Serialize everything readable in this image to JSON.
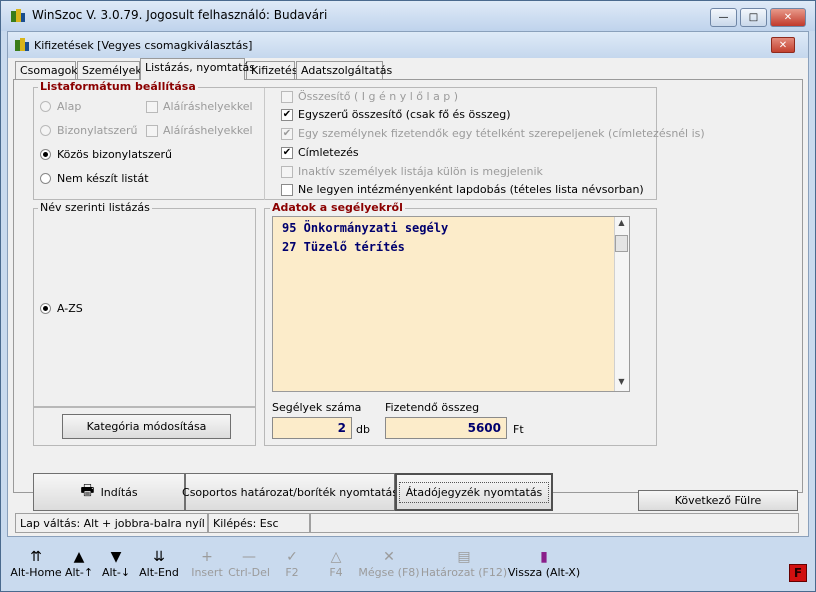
{
  "window": {
    "title": "WinSzoc V. 3.0.79.  Jogosult felhasználó: Budavári",
    "controls": {
      "minimize": "—",
      "maximize": "□",
      "close": "✕"
    }
  },
  "dialog": {
    "title": "Kifizetések  [Vegyes csomagkiválasztás]",
    "close": "✕"
  },
  "tabs": [
    "Csomagok",
    "Személyek",
    "Listázás, nyomtatás",
    "Kifizetés",
    "Adatszolgáltatás"
  ],
  "format_group": {
    "title": "Listaformátum beállítása",
    "radios": [
      {
        "label": "Alap",
        "checked": false,
        "disabled": true
      },
      {
        "label": "Bizonylatszerű",
        "checked": false,
        "disabled": true
      },
      {
        "label": "Közös bizonylatszerű",
        "checked": true,
        "disabled": false
      },
      {
        "label": "Nem készít listát",
        "checked": false,
        "disabled": false
      }
    ],
    "signature_checks": [
      "Aláíráshelyekkel",
      "Aláíráshelyekkel"
    ]
  },
  "options": [
    {
      "label": "Összesítő  ( I g é n y l ő l a p )",
      "checked": false,
      "disabled": true
    },
    {
      "label": "Egyszerű összesítő (csak fő és összeg)",
      "checked": true,
      "disabled": false
    },
    {
      "label": "Egy személynek fizetendők egy tételként szerepeljenek (címletezésnél is)",
      "checked": true,
      "disabled": true
    },
    {
      "label": "Címletezés",
      "checked": true,
      "disabled": false
    },
    {
      "label": "Inaktív személyek listája külön is megjelenik",
      "checked": false,
      "disabled": true
    },
    {
      "label": "Ne legyen intézményenként lapdobás (tételes lista névsorban)",
      "checked": false,
      "disabled": false
    }
  ],
  "name_group": {
    "title": "Név szerinti listázás",
    "radio_label": "A-ZS",
    "button": "Kategória módosítása"
  },
  "adatok": {
    "title": "Adatok a segélyekről",
    "items": [
      "95 Önkormányzati segély",
      "27 Tüzelő térítés"
    ],
    "count_label": "Segélyek száma",
    "count_value": "2",
    "count_unit": "db",
    "amount_label": "Fizetendő összeg",
    "amount_value": "5600",
    "amount_unit": "Ft"
  },
  "actions": {
    "start": "Indítás",
    "group_print": "Csoportos határozat/boríték nyomtatás",
    "transfer_print": "Átadójegyzék nyomtatás",
    "next_tab": "Következő Fülre"
  },
  "status": {
    "hint": "Lap váltás: Alt + jobbra-balra nyíl",
    "exit": "Kilépés: Esc"
  },
  "toolbar": [
    {
      "label": "Alt-Home",
      "icon": "⇈",
      "disabled": false
    },
    {
      "label": "Alt-↑",
      "icon": "▲",
      "disabled": false
    },
    {
      "label": "Alt-↓",
      "icon": "▼",
      "disabled": false
    },
    {
      "label": "Alt-End",
      "icon": "⇊",
      "disabled": false
    },
    {
      "label": "Insert",
      "icon": "+",
      "disabled": true
    },
    {
      "label": "Ctrl-Del",
      "icon": "—",
      "disabled": true
    },
    {
      "label": "F2",
      "icon": "✓",
      "disabled": true
    },
    {
      "label": "F4",
      "icon": "△",
      "disabled": true
    },
    {
      "label": "Mégse (F8)",
      "icon": "✕",
      "disabled": true
    },
    {
      "label": "Határozat (F12)",
      "icon": "▤",
      "disabled": true
    },
    {
      "label": "Vissza (Alt-X)",
      "icon": "▮",
      "disabled": false
    }
  ],
  "colors": {
    "accent_red": "#8b0000",
    "list_bg": "#fcecca",
    "list_text": "#00006e"
  }
}
